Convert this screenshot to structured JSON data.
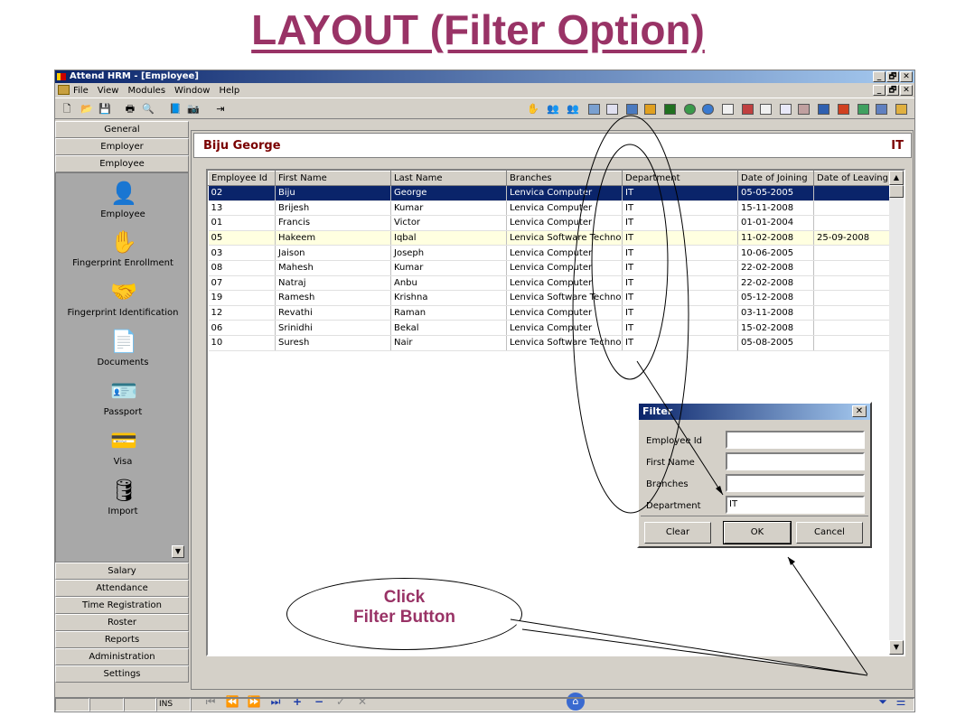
{
  "slide": {
    "title": "LAYOUT (Filter Option)"
  },
  "window": {
    "title": "Attend HRM - [Employee]",
    "min": "_",
    "max": "🗗",
    "close": "✕"
  },
  "menu": [
    "File",
    "View",
    "Modules",
    "Window",
    "Help"
  ],
  "nav_top": [
    "General",
    "Employer",
    "Employee"
  ],
  "nav_items": [
    {
      "label": "Employee",
      "icon": "employee-icon",
      "glyph": "👤"
    },
    {
      "label": "Fingerprint Enrollment",
      "icon": "hand-icon",
      "glyph": "✋"
    },
    {
      "label": "Fingerprint Identification",
      "icon": "handshake-icon",
      "glyph": "🤝"
    },
    {
      "label": "Documents",
      "icon": "documents-icon",
      "glyph": "📄"
    },
    {
      "label": "Passport",
      "icon": "passport-icon",
      "glyph": "🪪"
    },
    {
      "label": "Visa",
      "icon": "visa-icon",
      "glyph": "💳"
    },
    {
      "label": "Import",
      "icon": "import-icon",
      "glyph": "🛢"
    }
  ],
  "nav_bottom": [
    "Salary",
    "Attendance",
    "Time Registration",
    "Roster",
    "Reports",
    "Administration",
    "Settings"
  ],
  "header": {
    "name": "Biju George",
    "dept": "IT"
  },
  "table": {
    "columns": [
      "Employee Id",
      "First Name",
      "Last Name",
      "Branches",
      "Department",
      "Date of Joining",
      "Date of Leaving"
    ],
    "rows": [
      [
        "02",
        "Biju",
        "George",
        "Lenvica Computer",
        "IT",
        "05-05-2005",
        ""
      ],
      [
        "13",
        "Brijesh",
        "Kumar",
        "Lenvica Computer",
        "IT",
        "15-11-2008",
        ""
      ],
      [
        "01",
        "Francis",
        "Victor",
        "Lenvica Computer",
        "IT",
        "01-01-2004",
        ""
      ],
      [
        "05",
        "Hakeem",
        "Iqbal",
        "Lenvica Software Technolog",
        "IT",
        "11-02-2008",
        "25-09-2008"
      ],
      [
        "03",
        "Jaison",
        "Joseph",
        "Lenvica Computer",
        "IT",
        "10-06-2005",
        ""
      ],
      [
        "08",
        "Mahesh",
        "Kumar",
        "Lenvica Computer",
        "IT",
        "22-02-2008",
        ""
      ],
      [
        "07",
        "Natraj",
        "Anbu",
        "Lenvica Computer",
        "IT",
        "22-02-2008",
        ""
      ],
      [
        "19",
        "Ramesh",
        "Krishna",
        "Lenvica Software Technolog",
        "IT",
        "05-12-2008",
        ""
      ],
      [
        "12",
        "Revathi",
        "Raman",
        "Lenvica Computer",
        "IT",
        "03-11-2008",
        ""
      ],
      [
        "06",
        "Srinidhi",
        "Bekal",
        "Lenvica Computer",
        "IT",
        "15-02-2008",
        ""
      ],
      [
        "10",
        "Suresh",
        "Nair",
        "Lenvica Software Technolog",
        "IT",
        "05-08-2005",
        ""
      ]
    ]
  },
  "status": {
    "ins": "INS"
  },
  "filter": {
    "title": "Filter",
    "fields": [
      {
        "label": "Employee Id",
        "value": ""
      },
      {
        "label": "First Name",
        "value": ""
      },
      {
        "label": "Branches",
        "value": ""
      },
      {
        "label": "Department",
        "value": "IT"
      }
    ],
    "buttons": [
      "Clear",
      "OK",
      "Cancel"
    ]
  },
  "callout": {
    "line1": "Click",
    "line2": "Filter Button"
  },
  "colors": {
    "accent": "#993366",
    "selection": "#0a246a",
    "header_text": "#7a0000"
  }
}
